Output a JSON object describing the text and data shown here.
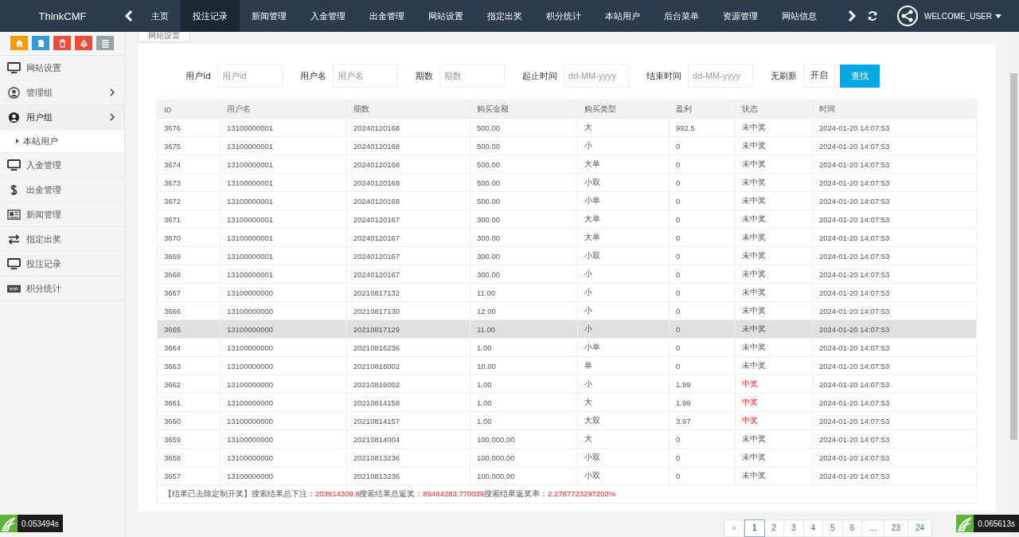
{
  "topbar": {
    "brand": "ThinkCMF",
    "tabs": [
      {
        "label": "主页",
        "selected": false
      },
      {
        "label": "投注记录",
        "selected": true
      },
      {
        "label": "新闻管理",
        "selected": false
      },
      {
        "label": "入金管理",
        "selected": false
      },
      {
        "label": "出金管理",
        "selected": false
      },
      {
        "label": "网站设置",
        "selected": false
      },
      {
        "label": "指定出奖",
        "selected": false
      },
      {
        "label": "积分统计",
        "selected": false
      },
      {
        "label": "本站用户",
        "selected": false
      },
      {
        "label": "后台菜单",
        "selected": false
      },
      {
        "label": "资源管理",
        "selected": false
      },
      {
        "label": "网站信息",
        "selected": false
      }
    ],
    "user": "WELCOME_USER"
  },
  "sidebar": {
    "toolbar": [
      {
        "color": "#f39c12"
      },
      {
        "color": "#3498db"
      },
      {
        "color": "#e74c3c"
      },
      {
        "color": "#e74c3c"
      },
      {
        "color": "#95a5a6"
      }
    ],
    "items": [
      {
        "label": "网站设置",
        "expanded": false,
        "has_children": false
      },
      {
        "label": "管理组",
        "expanded": false,
        "has_children": true
      },
      {
        "label": "用户组",
        "expanded": true,
        "has_children": true,
        "children": [
          {
            "label": "本站用户"
          }
        ]
      },
      {
        "label": "入金管理",
        "expanded": false,
        "has_children": false
      },
      {
        "label": "出金管理",
        "expanded": false,
        "has_children": false
      },
      {
        "label": "新闻管理",
        "expanded": false,
        "has_children": false
      },
      {
        "label": "指定出奖",
        "expanded": false,
        "has_children": false
      },
      {
        "label": "投注记录",
        "expanded": false,
        "has_children": false
      },
      {
        "label": "积分统计",
        "expanded": false,
        "has_children": false
      }
    ]
  },
  "page_tab": "网站设置",
  "filters": [
    {
      "label": "用户id",
      "placeholder": "用户id"
    },
    {
      "label": "用户名",
      "placeholder": "用户名"
    },
    {
      "label": "期数",
      "placeholder": "期数"
    },
    {
      "label": "起止时间",
      "placeholder": "dd-MM-yyyy"
    },
    {
      "label": "结束时间",
      "placeholder": "dd-MM-yyyy"
    },
    {
      "label": "无刷新",
      "value": "开启"
    }
  ],
  "search_button": "查找",
  "table": {
    "columns": [
      "ID",
      "用户名",
      "期数",
      "购买金额",
      "购买类型",
      "盈利",
      "状态",
      "时间"
    ],
    "rows": [
      {
        "cells": [
          "3676",
          "13100000001",
          "20240120168",
          "500.00",
          "大",
          "992.5",
          "未中奖",
          "2024-01-20 14:07:53"
        ],
        "won": false,
        "hovered": false
      },
      {
        "cells": [
          "3675",
          "13100000001",
          "20240120168",
          "500.00",
          "小",
          "0",
          "未中奖",
          "2024-01-20 14:07:53"
        ],
        "won": false,
        "hovered": false
      },
      {
        "cells": [
          "3674",
          "13100000001",
          "20240120168",
          "500.00",
          "大单",
          "0",
          "未中奖",
          "2024-01-20 14:07:53"
        ],
        "won": false,
        "hovered": false
      },
      {
        "cells": [
          "3673",
          "13100000001",
          "20240120168",
          "500.00",
          "小双",
          "0",
          "未中奖",
          "2024-01-20 14:07:53"
        ],
        "won": false,
        "hovered": false
      },
      {
        "cells": [
          "3672",
          "13100000001",
          "20240120168",
          "500.00",
          "小单",
          "0",
          "未中奖",
          "2024-01-20 14:07:53"
        ],
        "won": false,
        "hovered": false
      },
      {
        "cells": [
          "3671",
          "13100000001",
          "20240120167",
          "300.00",
          "大单",
          "0",
          "未中奖",
          "2024-01-20 14:07:53"
        ],
        "won": false,
        "hovered": false
      },
      {
        "cells": [
          "3670",
          "13100000001",
          "20240120167",
          "300.00",
          "大单",
          "0",
          "未中奖",
          "2024-01-20 14:07:53"
        ],
        "won": false,
        "hovered": false
      },
      {
        "cells": [
          "3669",
          "13100000001",
          "20240120167",
          "300.00",
          "小双",
          "0",
          "未中奖",
          "2024-01-20 14:07:53"
        ],
        "won": false,
        "hovered": false
      },
      {
        "cells": [
          "3668",
          "13100000001",
          "20240120167",
          "300.00",
          "小",
          "0",
          "未中奖",
          "2024-01-20 14:07:53"
        ],
        "won": false,
        "hovered": false
      },
      {
        "cells": [
          "3667",
          "13100000000",
          "20210817132",
          "11.00",
          "小",
          "0",
          "未中奖",
          "2024-01-20 14:07:53"
        ],
        "won": false,
        "hovered": false
      },
      {
        "cells": [
          "3666",
          "13100000000",
          "20210817130",
          "12.00",
          "小",
          "0",
          "未中奖",
          "2024-01-20 14:07:53"
        ],
        "won": false,
        "hovered": false
      },
      {
        "cells": [
          "3665",
          "13100000000",
          "20210817129",
          "11.00",
          "小",
          "0",
          "未中奖",
          "2024-01-20 14:07:53"
        ],
        "won": false,
        "hovered": true
      },
      {
        "cells": [
          "3664",
          "13100000000",
          "20210816236",
          "1.00",
          "小单",
          "0",
          "未中奖",
          "2024-01-20 14:07:53"
        ],
        "won": false,
        "hovered": false
      },
      {
        "cells": [
          "3663",
          "13100000000",
          "20210816002",
          "10.00",
          "单",
          "0",
          "未中奖",
          "2024-01-20 14:07:53"
        ],
        "won": false,
        "hovered": false
      },
      {
        "cells": [
          "3662",
          "13100000000",
          "20210816002",
          "1.00",
          "小",
          "1.99",
          "中奖",
          "2024-01-20 14:07:53"
        ],
        "won": true,
        "hovered": false
      },
      {
        "cells": [
          "3661",
          "13100000000",
          "20210814158",
          "1.00",
          "大",
          "1.99",
          "中奖",
          "2024-01-20 14:07:53"
        ],
        "won": true,
        "hovered": false
      },
      {
        "cells": [
          "3660",
          "13100000000",
          "20210814157",
          "1.00",
          "大双",
          "3.97",
          "中奖",
          "2024-01-20 14:07:53"
        ],
        "won": true,
        "hovered": false
      },
      {
        "cells": [
          "3659",
          "13100000000",
          "20210814004",
          "100,000.00",
          "大",
          "0",
          "未中奖",
          "2024-01-20 14:07:53"
        ],
        "won": false,
        "hovered": false
      },
      {
        "cells": [
          "3658",
          "13100000000",
          "20210813236",
          "100,000.00",
          "小双",
          "0",
          "未中奖",
          "2024-01-20 14:07:53"
        ],
        "won": false,
        "hovered": false
      },
      {
        "cells": [
          "3657",
          "13100000000",
          "20210813236",
          "100,000.00",
          "小双",
          "0",
          "未中奖",
          "2024-01-20 14:07:53"
        ],
        "won": false,
        "hovered": false
      }
    ]
  },
  "summary": [
    {
      "label": "【结果已去除定制开奖】搜索结果总下注：",
      "value": "203914309.8"
    },
    {
      "label": "搜索结果总返奖：",
      "value": "89484283.770039"
    },
    {
      "label": "搜索结果返奖率：",
      "value": "2.2787723297203%"
    }
  ],
  "pagination": [
    {
      "label": "«",
      "selected": false
    },
    {
      "label": "1",
      "selected": true
    },
    {
      "label": "2",
      "selected": false
    },
    {
      "label": "3",
      "selected": false
    },
    {
      "label": "4",
      "selected": false
    },
    {
      "label": "5",
      "selected": false
    },
    {
      "label": "6",
      "selected": false
    },
    {
      "label": "...",
      "selected": false
    },
    {
      "label": "23",
      "selected": false
    },
    {
      "label": "24",
      "selected": false
    }
  ],
  "timers": [
    "0.053494s",
    "0.065613s"
  ]
}
